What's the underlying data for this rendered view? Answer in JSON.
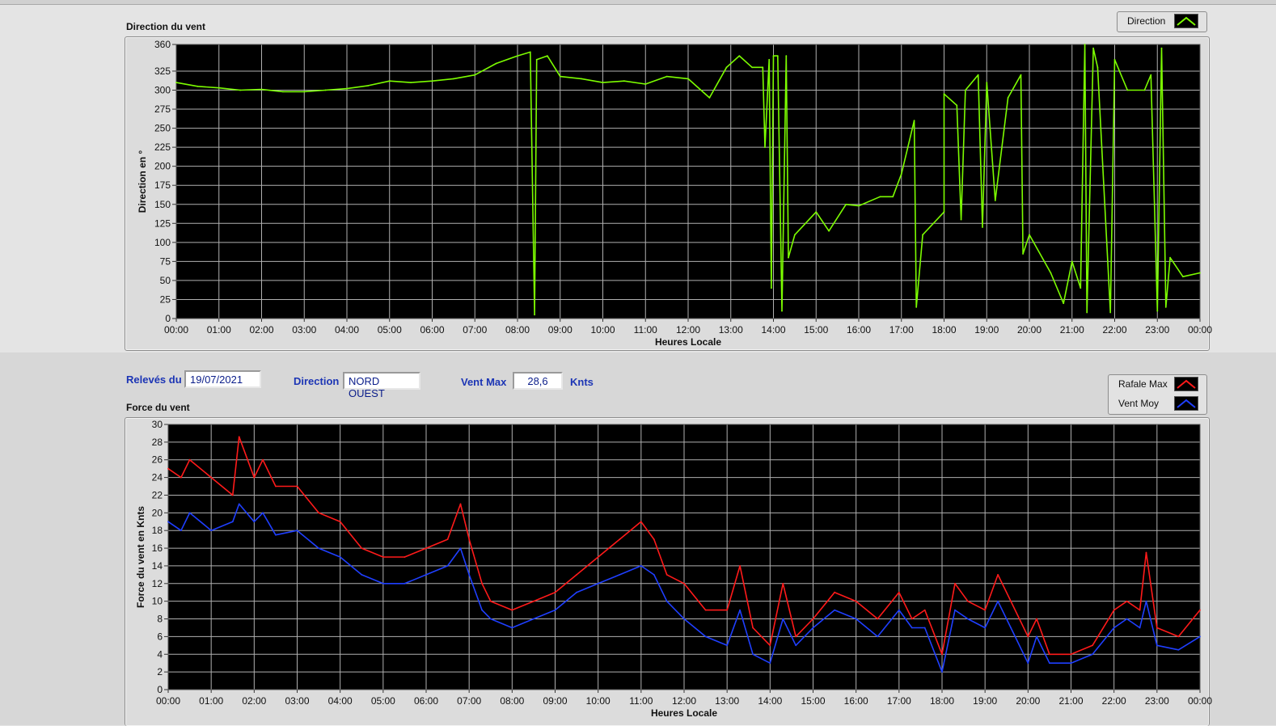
{
  "top_panel": {
    "title": "Direction du vent",
    "legend": [
      {
        "label": "Direction",
        "color": "#7cfc00"
      }
    ]
  },
  "controls": {
    "date_label": "Relevés du",
    "date_value": "19/07/2021",
    "direction_label": "Direction",
    "direction_value": "NORD OUEST",
    "ventmax_label": "Vent Max",
    "ventmax_value": "28,6",
    "ventmax_unit": "Knts"
  },
  "bottom_panel": {
    "title": "Force du vent",
    "legend": [
      {
        "label": "Rafale Max",
        "color": "#ff1a1a"
      },
      {
        "label": "Vent Moy",
        "color": "#1f3fff"
      }
    ]
  },
  "chart_data": [
    {
      "type": "line",
      "xlabel": "Heures Locale",
      "ylabel": "Direction en °",
      "xticks": [
        "00:00",
        "01:00",
        "02:00",
        "03:00",
        "04:00",
        "05:00",
        "06:00",
        "07:00",
        "08:00",
        "09:00",
        "10:00",
        "11:00",
        "12:00",
        "13:00",
        "14:00",
        "15:00",
        "16:00",
        "17:00",
        "18:00",
        "19:00",
        "20:00",
        "21:00",
        "22:00",
        "23:00",
        "00:00"
      ],
      "ylim": [
        0,
        360
      ],
      "yticks": [
        0,
        25,
        50,
        75,
        100,
        125,
        150,
        175,
        200,
        225,
        250,
        275,
        300,
        325,
        360
      ],
      "xlim": [
        0,
        24
      ],
      "grid": true,
      "series": [
        {
          "name": "Direction",
          "color": "#7cfc00",
          "points": [
            [
              0,
              310
            ],
            [
              0.5,
              305
            ],
            [
              1,
              303
            ],
            [
              1.5,
              300
            ],
            [
              2,
              301
            ],
            [
              2.5,
              298
            ],
            [
              3,
              298
            ],
            [
              3.5,
              300
            ],
            [
              4,
              302
            ],
            [
              4.5,
              306
            ],
            [
              5,
              312
            ],
            [
              5.5,
              310
            ],
            [
              6,
              312
            ],
            [
              6.5,
              315
            ],
            [
              7,
              320
            ],
            [
              7.5,
              335
            ],
            [
              8,
              345
            ],
            [
              8.3,
              350
            ],
            [
              8.4,
              5
            ],
            [
              8.45,
              340
            ],
            [
              8.7,
              345
            ],
            [
              9,
              318
            ],
            [
              9.5,
              315
            ],
            [
              10,
              310
            ],
            [
              10.5,
              312
            ],
            [
              11,
              308
            ],
            [
              11.5,
              318
            ],
            [
              12,
              315
            ],
            [
              12.5,
              290
            ],
            [
              12.9,
              330
            ],
            [
              13.2,
              345
            ],
            [
              13.5,
              330
            ],
            [
              13.75,
              330
            ],
            [
              13.8,
              225
            ],
            [
              13.9,
              340
            ],
            [
              13.95,
              40
            ],
            [
              14,
              345
            ],
            [
              14.1,
              345
            ],
            [
              14.2,
              10
            ],
            [
              14.3,
              345
            ],
            [
              14.35,
              80
            ],
            [
              14.5,
              110
            ],
            [
              15,
              140
            ],
            [
              15.3,
              115
            ],
            [
              15.7,
              150
            ],
            [
              16,
              148
            ],
            [
              16.5,
              160
            ],
            [
              16.8,
              160
            ],
            [
              17,
              190
            ],
            [
              17.3,
              260
            ],
            [
              17.35,
              15
            ],
            [
              17.5,
              110
            ],
            [
              18,
              140
            ],
            [
              18,
              295
            ],
            [
              18.3,
              280
            ],
            [
              18.4,
              130
            ],
            [
              18.5,
              300
            ],
            [
              18.8,
              320
            ],
            [
              18.9,
              120
            ],
            [
              19,
              310
            ],
            [
              19.2,
              155
            ],
            [
              19.5,
              290
            ],
            [
              19.8,
              320
            ],
            [
              19.85,
              85
            ],
            [
              20,
              110
            ],
            [
              20.5,
              60
            ],
            [
              20.8,
              20
            ],
            [
              21,
              75
            ],
            [
              21.2,
              40
            ],
            [
              21.3,
              360
            ],
            [
              21.35,
              8
            ],
            [
              21.5,
              355
            ],
            [
              21.6,
              330
            ],
            [
              21.9,
              8
            ],
            [
              22,
              340
            ],
            [
              22.3,
              300
            ],
            [
              22.7,
              300
            ],
            [
              22.85,
              320
            ],
            [
              23,
              10
            ],
            [
              23.1,
              355
            ],
            [
              23.2,
              15
            ],
            [
              23.3,
              80
            ],
            [
              23.6,
              55
            ],
            [
              24,
              60
            ]
          ]
        }
      ]
    },
    {
      "type": "line",
      "xlabel": "Heures Locale",
      "ylabel": "Force du vent en Knts",
      "xticks": [
        "00:00",
        "01:00",
        "02:00",
        "03:00",
        "04:00",
        "05:00",
        "06:00",
        "07:00",
        "08:00",
        "09:00",
        "10:00",
        "11:00",
        "12:00",
        "13:00",
        "14:00",
        "15:00",
        "16:00",
        "17:00",
        "18:00",
        "19:00",
        "20:00",
        "21:00",
        "22:00",
        "23:00",
        "00:00"
      ],
      "ylim": [
        0,
        30
      ],
      "yticks": [
        0,
        2,
        4,
        6,
        8,
        10,
        12,
        14,
        16,
        18,
        20,
        22,
        24,
        26,
        28,
        30
      ],
      "xlim": [
        0,
        24
      ],
      "grid": true,
      "series": [
        {
          "name": "Rafale Max",
          "color": "#ff1a1a",
          "points": [
            [
              0,
              25
            ],
            [
              0.3,
              24
            ],
            [
              0.5,
              26
            ],
            [
              1,
              24
            ],
            [
              1.5,
              22
            ],
            [
              1.65,
              28.6
            ],
            [
              2,
              24
            ],
            [
              2.2,
              26
            ],
            [
              2.5,
              23
            ],
            [
              3,
              23
            ],
            [
              3.5,
              20
            ],
            [
              4,
              19
            ],
            [
              4.5,
              16
            ],
            [
              5,
              15
            ],
            [
              5.5,
              15
            ],
            [
              6,
              16
            ],
            [
              6.5,
              17
            ],
            [
              6.8,
              21
            ],
            [
              7,
              17
            ],
            [
              7.3,
              12
            ],
            [
              7.5,
              10
            ],
            [
              8,
              9
            ],
            [
              8.5,
              10
            ],
            [
              9,
              11
            ],
            [
              9.5,
              13
            ],
            [
              10,
              15
            ],
            [
              10.5,
              17
            ],
            [
              11,
              19
            ],
            [
              11.3,
              17
            ],
            [
              11.6,
              13
            ],
            [
              12,
              12
            ],
            [
              12.5,
              9
            ],
            [
              13,
              9
            ],
            [
              13.3,
              14
            ],
            [
              13.6,
              7
            ],
            [
              14,
              5
            ],
            [
              14.3,
              12
            ],
            [
              14.6,
              6
            ],
            [
              15,
              8
            ],
            [
              15.5,
              11
            ],
            [
              16,
              10
            ],
            [
              16.5,
              8
            ],
            [
              17,
              11
            ],
            [
              17.3,
              8
            ],
            [
              17.6,
              9
            ],
            [
              18,
              4
            ],
            [
              18.3,
              12
            ],
            [
              18.6,
              10
            ],
            [
              19,
              9
            ],
            [
              19.3,
              13
            ],
            [
              19.6,
              10
            ],
            [
              20,
              6
            ],
            [
              20.2,
              8
            ],
            [
              20.5,
              4
            ],
            [
              21,
              4
            ],
            [
              21.5,
              5
            ],
            [
              22,
              9
            ],
            [
              22.3,
              10
            ],
            [
              22.6,
              9
            ],
            [
              22.75,
              15.5
            ],
            [
              23,
              7
            ],
            [
              23.5,
              6
            ],
            [
              24,
              9
            ]
          ]
        },
        {
          "name": "Vent Moy",
          "color": "#1f3fff",
          "points": [
            [
              0,
              19
            ],
            [
              0.3,
              18
            ],
            [
              0.5,
              20
            ],
            [
              1,
              18
            ],
            [
              1.5,
              19
            ],
            [
              1.65,
              21
            ],
            [
              2,
              19
            ],
            [
              2.2,
              20
            ],
            [
              2.5,
              17.5
            ],
            [
              3,
              18
            ],
            [
              3.5,
              16
            ],
            [
              4,
              15
            ],
            [
              4.5,
              13
            ],
            [
              5,
              12
            ],
            [
              5.5,
              12
            ],
            [
              6,
              13
            ],
            [
              6.5,
              14
            ],
            [
              6.8,
              16
            ],
            [
              7,
              13
            ],
            [
              7.3,
              9
            ],
            [
              7.5,
              8
            ],
            [
              8,
              7
            ],
            [
              8.5,
              8
            ],
            [
              9,
              9
            ],
            [
              9.5,
              11
            ],
            [
              10,
              12
            ],
            [
              10.5,
              13
            ],
            [
              11,
              14
            ],
            [
              11.3,
              13
            ],
            [
              11.6,
              10
            ],
            [
              12,
              8
            ],
            [
              12.5,
              6
            ],
            [
              13,
              5
            ],
            [
              13.3,
              9
            ],
            [
              13.6,
              4
            ],
            [
              14,
              3
            ],
            [
              14.3,
              8
            ],
            [
              14.6,
              5
            ],
            [
              15,
              7
            ],
            [
              15.5,
              9
            ],
            [
              16,
              8
            ],
            [
              16.5,
              6
            ],
            [
              17,
              9
            ],
            [
              17.3,
              7
            ],
            [
              17.6,
              7
            ],
            [
              18,
              2
            ],
            [
              18.3,
              9
            ],
            [
              18.6,
              8
            ],
            [
              19,
              7
            ],
            [
              19.3,
              10
            ],
            [
              19.6,
              7
            ],
            [
              20,
              3
            ],
            [
              20.2,
              6
            ],
            [
              20.5,
              3
            ],
            [
              21,
              3
            ],
            [
              21.5,
              4
            ],
            [
              22,
              7
            ],
            [
              22.3,
              8
            ],
            [
              22.6,
              7
            ],
            [
              22.75,
              10
            ],
            [
              23,
              5
            ],
            [
              23.5,
              4.5
            ],
            [
              24,
              6
            ]
          ]
        }
      ]
    }
  ]
}
